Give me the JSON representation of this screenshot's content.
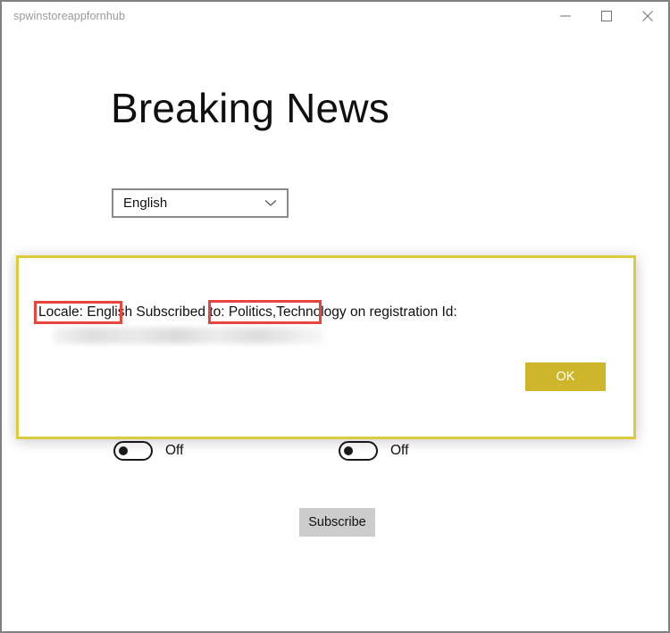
{
  "window": {
    "title": "spwinstoreappfornhub",
    "controls": {
      "minimize": "minimize-icon",
      "maximize": "maximize-icon",
      "close": "close-icon"
    }
  },
  "main": {
    "heading": "Breaking News",
    "locale_select": {
      "value": "English",
      "icon": "chevron-down-icon"
    },
    "toggles": [
      {
        "label": "Off",
        "state": "off"
      },
      {
        "label": "Off",
        "state": "off"
      }
    ],
    "subscribe_button": "Subscribe"
  },
  "dialog": {
    "message_parts": {
      "locale": "Locale: English",
      "subscribed_to_label": " Subscribed to: ",
      "topics": "Politics,Technology",
      "trailing": " on registration Id:"
    },
    "registration_id": "",
    "ok_button": "OK"
  },
  "annotations": [
    {
      "name": "locale-highlight",
      "target": "Locale: English"
    },
    {
      "name": "topics-highlight",
      "target": "Politics,Technology"
    }
  ],
  "colors": {
    "dialog_border": "#ddcb3e",
    "ok_button": "#cdb62c",
    "annotation": "#e8453c",
    "subscribe_button": "#cccccc",
    "window_border": "#808080"
  }
}
